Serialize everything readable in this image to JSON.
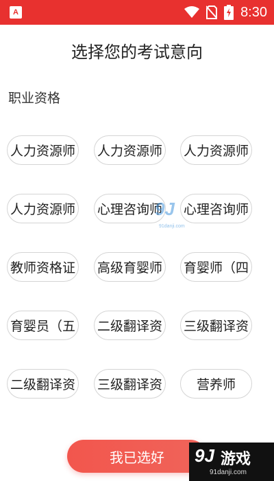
{
  "status_bar": {
    "time": "8:30",
    "icons": [
      "app-badge-icon",
      "wifi-icon",
      "no-sim-icon",
      "battery-charging-icon"
    ],
    "app_badge": "A"
  },
  "header": {
    "title": "选择您的考试意向"
  },
  "section": {
    "label": "职业资格"
  },
  "options": [
    "人力资源师",
    "人力资源师",
    "人力资源师",
    "人力资源师",
    "心理咨询师",
    "心理咨询师",
    "教师资格证",
    "高级育婴师",
    "育婴师（四",
    "育婴员（五",
    "二级翻译资",
    "三级翻译资",
    "二级翻译资",
    "三级翻译资",
    "营养师"
  ],
  "confirm_button": {
    "label": "我已选好"
  },
  "watermark": {
    "logo": "9J",
    "name": "游戏",
    "url": "91danji.com",
    "center_logo": "9J",
    "center_url": "91danji.com"
  },
  "colors": {
    "accent": "#e8312f",
    "chip_border": "#d4d4d4"
  }
}
